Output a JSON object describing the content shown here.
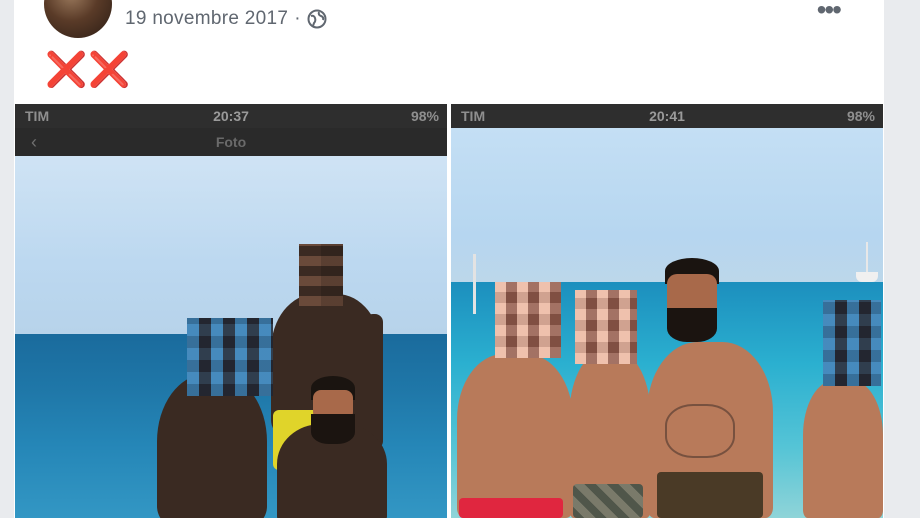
{
  "post": {
    "date": "19 novembre 2017",
    "separator": "·",
    "privacy_icon": "globe-icon",
    "more_icon": "more-options-icon",
    "text": "❌❌"
  },
  "photos": [
    {
      "status_bar": {
        "carrier": "TIM",
        "time": "20:37",
        "battery": "98%"
      },
      "app_title": "Foto"
    },
    {
      "status_bar": {
        "carrier": "TIM",
        "time": "20:41",
        "battery": "98%"
      }
    }
  ],
  "colors": {
    "post_text_red": "#e0201c",
    "meta_gray": "#606770",
    "card_bg": "#ffffff",
    "page_bg": "#e9ebee"
  }
}
